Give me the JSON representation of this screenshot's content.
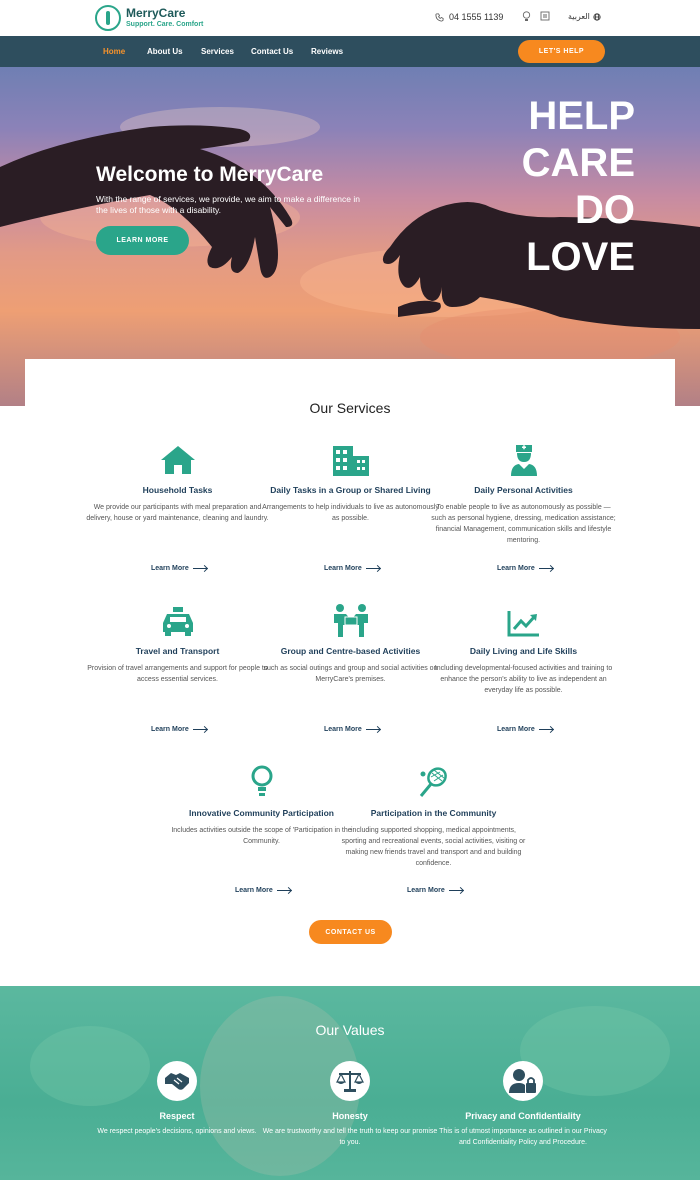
{
  "brand": {
    "name": "MerryCare",
    "tagline": "Support. Care. Comfort"
  },
  "topbar": {
    "phone": "04 1555 1139",
    "language": "العربية"
  },
  "nav": {
    "items": [
      "Home",
      "About Us",
      "Services",
      "Contact Us",
      "Reviews"
    ],
    "cta": "LET'S HELP"
  },
  "hero": {
    "title": "Welcome to MerryCare",
    "text": "With the range of services, we provide, we aim to make a difference in the lives of those with a disability.",
    "button": "LEARN MORE",
    "slogan": [
      "HELP",
      "CARE",
      "DO",
      "LOVE"
    ]
  },
  "services": {
    "title": "Our Services",
    "link_label": "Learn More",
    "items": [
      {
        "icon": "house-icon",
        "title": "Household Tasks",
        "desc": "We provide our participants with meal preparation and delivery, house or yard maintenance, cleaning and laundry."
      },
      {
        "icon": "building-icon",
        "title": "Daily Tasks in a Group or Shared Living",
        "desc": "Arrangements to help individuals to live as autonomously as possible."
      },
      {
        "icon": "nurse-icon",
        "title": "Daily Personal Activities",
        "desc": "To enable people to live as autonomously as possible — such as personal hygiene, dressing, medication assistance; financial Management, communication skills and lifestyle mentoring."
      },
      {
        "icon": "taxi-icon",
        "title": "Travel and Transport",
        "desc": "Provision of travel arrangements and support for people to access essential services."
      },
      {
        "icon": "group-icon",
        "title": "Group and Centre-based Activities",
        "desc": "such as social outings and group and social activities on MerryCare's premises."
      },
      {
        "icon": "chart-icon",
        "title": "Daily Living and Life Skills",
        "desc": "Including developmental-focused activities and training to enhance the person's ability to live as independent an everyday life as possible."
      },
      {
        "icon": "lightbulb-icon",
        "title": "Innovative Community Participation",
        "desc": "Includes activities outside the scope of 'Participation in the Community."
      },
      {
        "icon": "tennis-icon",
        "title": "Participation in the Community",
        "desc": "including supported shopping, medical appointments, sporting and recreational events, social activities, visiting or making new friends travel and transport and and building confidence."
      }
    ],
    "contact_button": "CONTACT US"
  },
  "values": {
    "title": "Our Values",
    "items": [
      {
        "icon": "handshake-icon",
        "name": "Respect",
        "desc": "We respect people's decisions, opinions and views."
      },
      {
        "icon": "scales-icon",
        "name": "Honesty",
        "desc": "We are trustworthy and tell the truth to keep our promise to you."
      },
      {
        "icon": "user-lock-icon",
        "name": "Privacy and Confidentiality",
        "desc": "This is of utmost importance as outlined in our Privacy and Confidentiality Policy and Procedure."
      }
    ]
  },
  "colors": {
    "teal": "#2aa58a",
    "orange": "#f7891f",
    "nav": "#2e4e5e",
    "dark_text": "#1f3f5a"
  }
}
